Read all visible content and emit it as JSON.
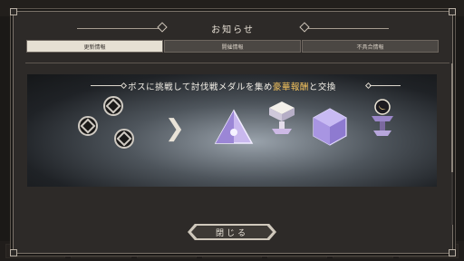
{
  "modal": {
    "title": "お知らせ",
    "tabs": [
      {
        "label": "更新情報",
        "active": true
      },
      {
        "label": "開催情報",
        "active": false
      },
      {
        "label": "不具合情報",
        "active": false
      }
    ],
    "banner": {
      "headline_pre": "ボスに挑戦して討伐戦メダルを集め",
      "headline_highlight": "豪華報酬",
      "headline_post": "と交換"
    },
    "close_label": "閉じる"
  },
  "colors": {
    "highlight": "#f2c15c",
    "active_tab": "#e6e0d3",
    "panel": "#2d2a28"
  },
  "icons": [
    "medal-icon",
    "arrow-right-icon",
    "crystal-pyramid-icon",
    "pedestal-icon",
    "crystal-cube-icon",
    "orb-pedestal-icon"
  ]
}
